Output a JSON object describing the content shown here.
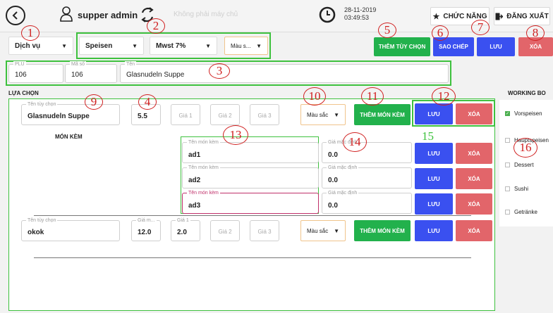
{
  "topbar": {
    "user": "supper admin",
    "connection": "Không phải máy chủ",
    "date": "28-11-2019",
    "time": "03:49:53",
    "function_btn": "CHỨC NĂNG",
    "logout_btn": "ĐĂNG XUẤT"
  },
  "filters": {
    "category": "Dịch vụ",
    "type": "Speisen",
    "tax": "Mwst 7%",
    "color": "Màu s..."
  },
  "actions": {
    "add_option": "THÊM TÙY CHỌN",
    "copy": "SAO CHÉP",
    "save": "LƯU",
    "delete": "XÓA"
  },
  "product": {
    "plu_label": "PLU",
    "plu": "106",
    "code_label": "Mã số",
    "code": "106",
    "name_label": "Tên",
    "name": "Glasnudeln Suppe"
  },
  "options_section": "LỰA CHỌN",
  "options": [
    {
      "name_label": "Tên tùy chọn",
      "name": "Glasnudeln Suppe",
      "price": "5.5",
      "price1_ph": "Giá 1",
      "price2_ph": "Giá 2",
      "price3_ph": "Giá 3",
      "color": "Màu sắc",
      "add_side_btn": "THÊM MÓN KÈM",
      "save_btn": "LƯU",
      "delete_btn": "XÓA"
    },
    {
      "name_label": "Tên tùy chọn",
      "name": "okok",
      "price_label": "Giá m...",
      "price": "12.0",
      "price1_label": "Giá 1",
      "price1": "2.0",
      "price2_ph": "Giá 2",
      "price3_ph": "Giá 3",
      "color": "Màu sắc",
      "add_side_btn": "THÊM MÓN KÈM",
      "save_btn": "LƯU",
      "delete_btn": "XÓA"
    }
  ],
  "side_dishes_title": "MÓN KÈM",
  "side_dishes": [
    {
      "name_label": "Tên món kèm",
      "name": "ad1",
      "price_label": "Giá mặc định",
      "price": "0.0",
      "save": "LƯU",
      "delete": "XÓA"
    },
    {
      "name_label": "Tên món kèm",
      "name": "ad2",
      "price_label": "Giá mặc định",
      "price": "0.0",
      "save": "LƯU",
      "delete": "XÓA"
    },
    {
      "name_label": "Tên món kèm",
      "name": "ad3",
      "price_label": "Giá mặc định",
      "price": "0.0",
      "save": "LƯU",
      "delete": "XÓA"
    }
  ],
  "working_board": {
    "title": "WORKING BO",
    "items": [
      "Vorspeisen",
      "Hauptspeisen",
      "Dessert",
      "Sushi",
      "Getränke"
    ]
  },
  "annotations": [
    "1",
    "2",
    "3",
    "4",
    "5",
    "6",
    "7",
    "8",
    "9",
    "10",
    "11",
    "12",
    "13",
    "14",
    "15",
    "16"
  ]
}
